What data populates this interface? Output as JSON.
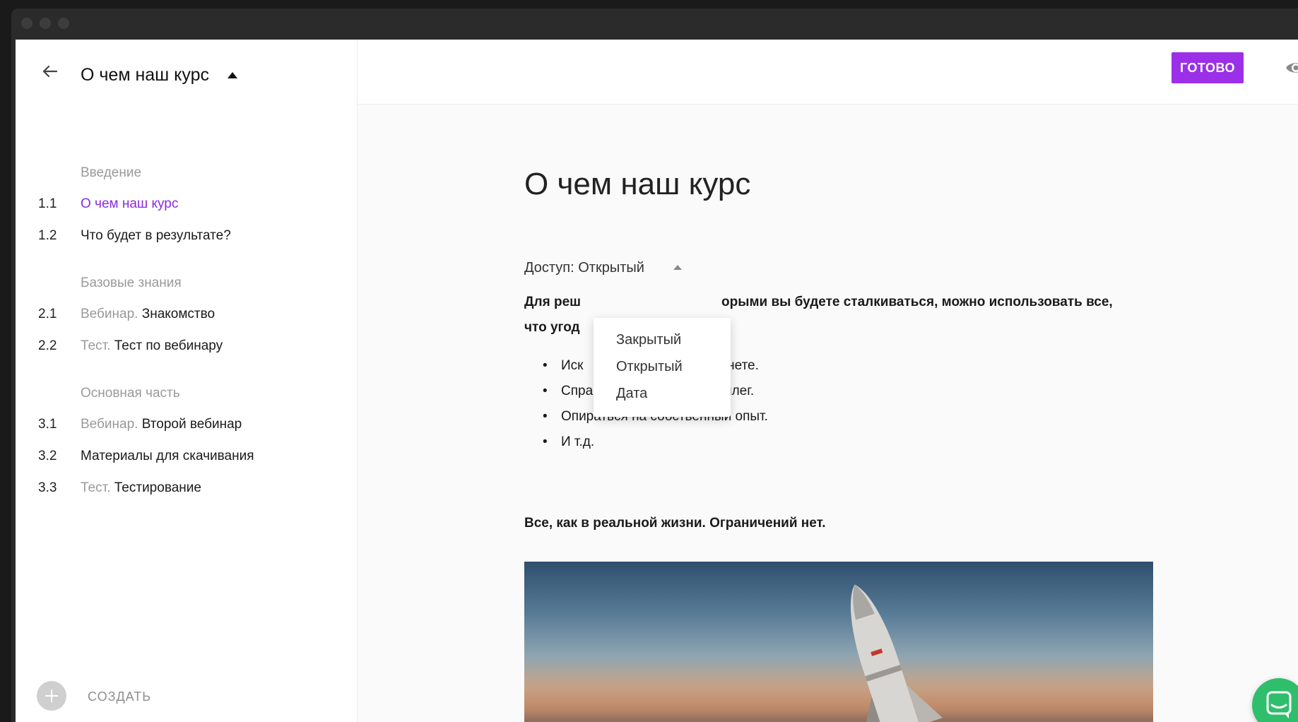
{
  "sidebar": {
    "course_title": "О чем наш курс",
    "sections": [
      {
        "title": "Введение",
        "items": [
          {
            "num": "1.1",
            "type": "",
            "label": "О чем наш курс",
            "active": true
          },
          {
            "num": "1.2",
            "type": "",
            "label": "Что будет в результате?"
          }
        ]
      },
      {
        "title": "Базовые знания",
        "items": [
          {
            "num": "2.1",
            "type": "Вебинар.",
            "label": "Знакомство"
          },
          {
            "num": "2.2",
            "type": "Тест.",
            "label": "Тест по вебинару"
          }
        ]
      },
      {
        "title": "Основная часть",
        "items": [
          {
            "num": "3.1",
            "type": "Вебинар.",
            "label": "Второй вебинар"
          },
          {
            "num": "3.2",
            "type": "",
            "label": "Материалы для скачивания"
          },
          {
            "num": "3.3",
            "type": "Тест.",
            "label": "Тестирование"
          }
        ]
      }
    ],
    "create_label": "СОЗДАТЬ"
  },
  "toolbar": {
    "done_label": "ГОТОВО"
  },
  "content": {
    "title": "О чем наш курс",
    "access_label": "Доступ:",
    "access_value": "Открытый",
    "paragraph_line1_start": "Для реш",
    "paragraph_line1_end": "орыми вы будете сталкиваться, можно использовать все,",
    "paragraph_line2_start": "что угод",
    "bullets": [
      {
        "start": "Иск",
        "end": "ернете."
      },
      {
        "start": "Спрашивать у опытных коллег.",
        "end": ""
      },
      {
        "start": "Опираться на собственный опыт.",
        "end": ""
      },
      {
        "start": "И т.д.",
        "end": ""
      }
    ],
    "paragraph2": "Все, как в реальной жизни. Ограничений нет."
  },
  "access_dropdown": {
    "options": [
      "Закрытый",
      "Открытый",
      "Дата"
    ]
  },
  "colors": {
    "accent": "#9b30e8",
    "active_link": "#8a2be2",
    "chat": "#2fbe6c"
  },
  "icons": {
    "back": "arrow-left-icon",
    "eye": "eye-icon",
    "plus": "plus-icon",
    "chat": "chat-icon"
  }
}
